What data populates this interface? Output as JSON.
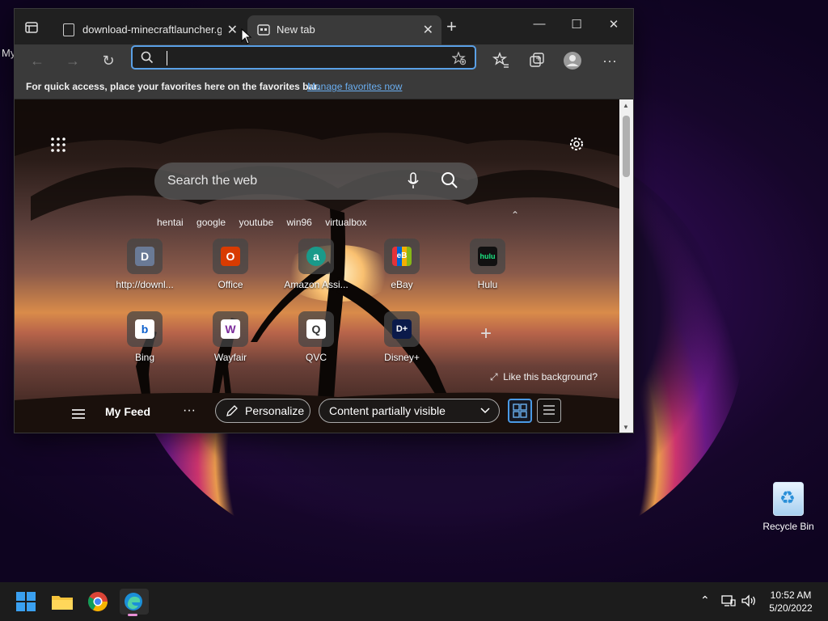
{
  "desktop": {
    "stub_label": "My",
    "recycle_bin": "Recycle Bin"
  },
  "browser": {
    "tabs": [
      {
        "title": "download-minecraftlauncher.glit",
        "active": false
      },
      {
        "title": "New tab",
        "active": true
      }
    ],
    "address": {
      "value": "",
      "placeholder": ""
    },
    "favorites_bar": {
      "text": "For quick access, place your favorites here on the favorites bar.",
      "link": "Manage favorites now"
    }
  },
  "newtab": {
    "search_placeholder": "Search the web",
    "quick_searches": [
      "hentai",
      "google",
      "youtube",
      "win96",
      "virtualbox"
    ],
    "tiles": [
      {
        "label": "http://downl...",
        "icon": "D",
        "color": "#5a6a8a"
      },
      {
        "label": "Office",
        "icon": "O",
        "color": "#d83b01"
      },
      {
        "label": "Amazon Assi...",
        "icon": "a",
        "color": "#1a9a8a"
      },
      {
        "label": "eBay",
        "icon": "eB",
        "color": "#2a2a2a"
      },
      {
        "label": "Hulu",
        "icon": "hulu",
        "color": "#111111"
      },
      {
        "label": "Bing",
        "icon": "b",
        "color": "#ffffff"
      },
      {
        "label": "Wayfair",
        "icon": "W",
        "color": "#ffffff"
      },
      {
        "label": "QVC",
        "icon": "Q",
        "color": "#ffffff"
      },
      {
        "label": "Disney+",
        "icon": "D+",
        "color": "#0b1a4a"
      }
    ],
    "like_background": "Like this background?",
    "feed": {
      "title": "My Feed",
      "personalize": "Personalize",
      "content_mode": "Content partially visible"
    }
  },
  "taskbar": {
    "time": "10:52 AM",
    "date": "5/20/2022"
  },
  "colors": {
    "accent": "#5aa0e6",
    "link": "#6aaef0",
    "taskbar": "#1c1c1c"
  }
}
